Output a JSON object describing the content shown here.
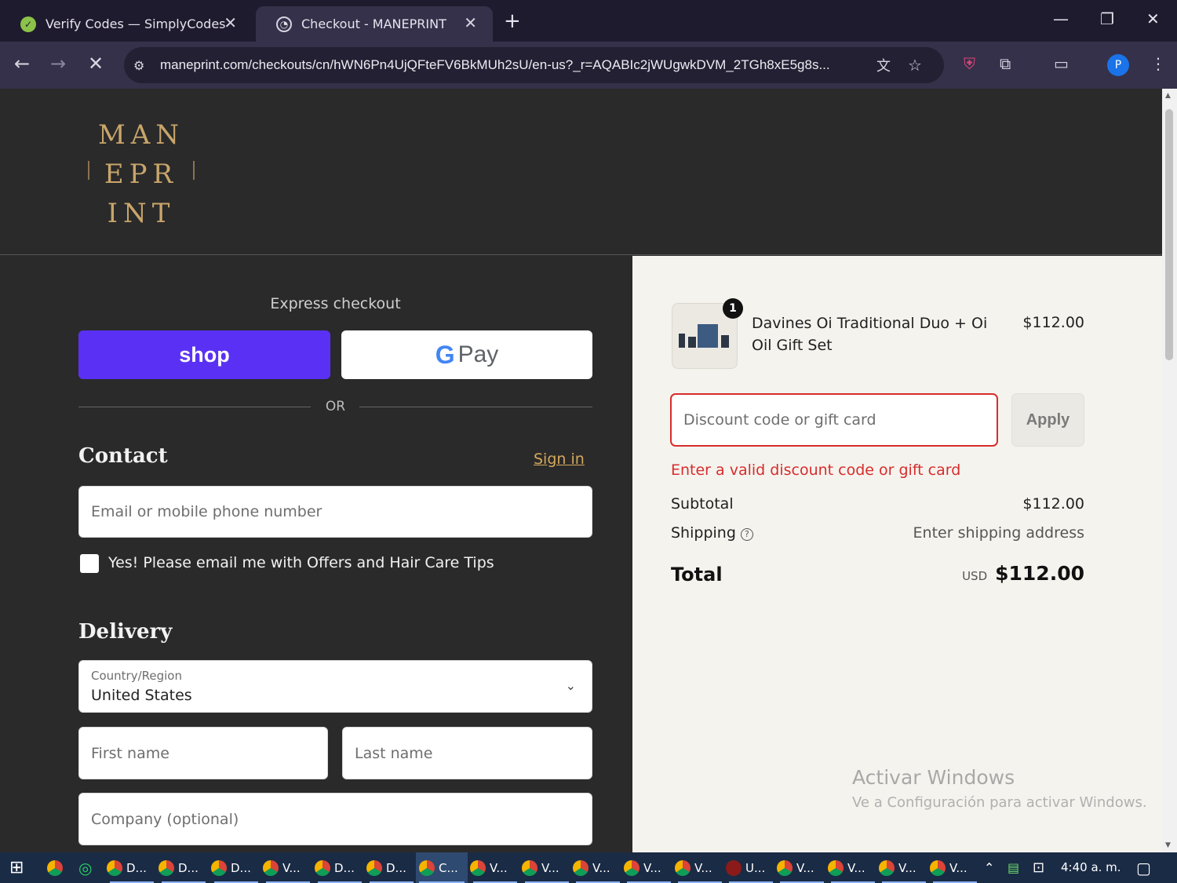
{
  "browser": {
    "tabs": [
      {
        "title": "Verify Codes — SimplyCodes",
        "active": false
      },
      {
        "title": "Checkout - MANEPRINT",
        "active": true
      }
    ],
    "url": "maneprint.com/checkouts/cn/hWN6Pn4UjQFteFV6BkMUh2sU/en-us?_r=AQABIc2jWUgwkDVM_2TGh8xE5g8s...",
    "profile_initial": "P"
  },
  "store": {
    "logo_lines": [
      "MAN",
      "EPR",
      "INT"
    ]
  },
  "checkout": {
    "express_label": "Express checkout",
    "shop_label": "shop",
    "gpay_label": "Pay",
    "or_label": "OR",
    "contact_title": "Contact",
    "signin_label": "Sign in",
    "email_placeholder": "Email or mobile phone number",
    "marketing_label": "Yes! Please email me with Offers and Hair Care Tips",
    "delivery_title": "Delivery",
    "country_label": "Country/Region",
    "country_value": "United States",
    "first_name_placeholder": "First name",
    "last_name_placeholder": "Last name",
    "company_placeholder": "Company (optional)"
  },
  "summary": {
    "item": {
      "name": "Davines Oi Traditional Duo + Oi Oil Gift Set",
      "price": "$112.00",
      "quantity": "1"
    },
    "discount_placeholder": "Discount code or gift card",
    "apply_label": "Apply",
    "discount_error": "Enter a valid discount code or gift card",
    "subtotal_label": "Subtotal",
    "subtotal_value": "$112.00",
    "shipping_label": "Shipping",
    "shipping_value": "Enter shipping address",
    "total_label": "Total",
    "total_currency": "USD",
    "total_value": "$112.00"
  },
  "watermark": {
    "title": "Activar Windows",
    "subtitle": "Ve a Configuración para activar Windows."
  },
  "taskbar": {
    "items": [
      "D...",
      "D...",
      "D...",
      "V...",
      "D...",
      "D...",
      "C...",
      "V...",
      "V...",
      "V...",
      "V...",
      "V...",
      "U...",
      "V...",
      "V...",
      "V...",
      "V..."
    ],
    "clock": "4:40 a. m."
  },
  "colors": {
    "shop_purple": "#5a31f4",
    "error_red": "#d72c2c",
    "link_gold": "#d6a85c",
    "page_dark": "#2a2a2a",
    "summary_bg": "#f5f3ee"
  }
}
